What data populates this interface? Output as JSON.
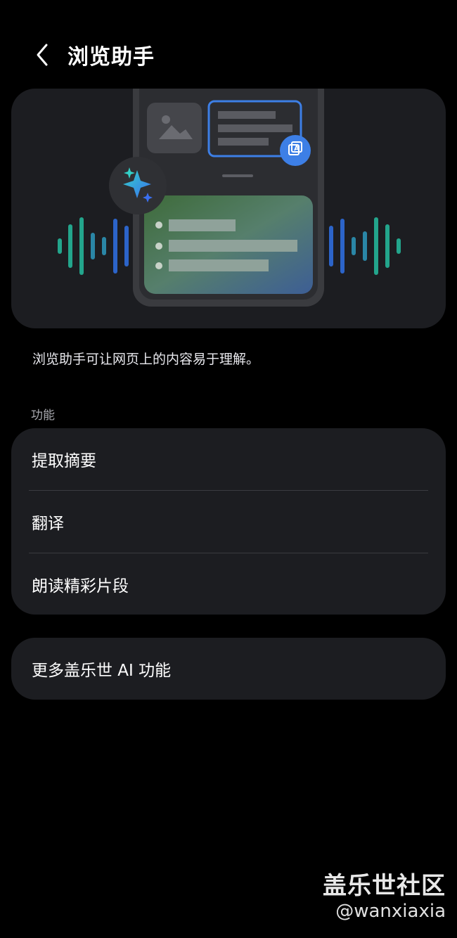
{
  "header": {
    "title": "浏览助手",
    "back_icon": "chevron-left-icon"
  },
  "hero": {
    "icons": [
      "sparkle-icon",
      "translate-icon",
      "image-icon"
    ]
  },
  "description": "浏览助手可让网页上的内容易于理解。",
  "features": {
    "section_title": "功能",
    "items": [
      {
        "label": "提取摘要"
      },
      {
        "label": "翻译"
      },
      {
        "label": "朗读精彩片段"
      }
    ]
  },
  "more": {
    "label": "更多盖乐世 AI 功能"
  },
  "watermark": {
    "brand": "盖乐世社区",
    "handle": "@wanxiaxia"
  },
  "colors": {
    "accent": "#3d7fe6",
    "card": "#1c1d21",
    "bg": "#000000",
    "wave_teal": "#23a58c",
    "wave_blue": "#2c64c9"
  }
}
